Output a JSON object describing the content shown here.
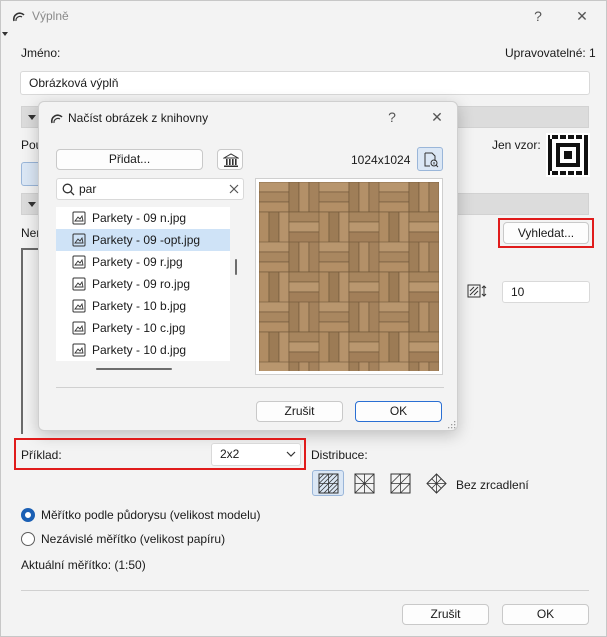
{
  "window": {
    "title": "Výplně",
    "help": "?",
    "close": "✕"
  },
  "name_section": {
    "label": "Jméno:",
    "editable_label": "Upravovatelné: 1",
    "value": "Obrázková výplň"
  },
  "behind": {
    "pou_label": "Pou",
    "jen_vzor_label": "Jen vzor:",
    "nem_label": "Nem",
    "search_button": "Vyhledat...",
    "size_value": "10"
  },
  "inner_dialog": {
    "title": "Načíst obrázek z knihovny",
    "help": "?",
    "close": "✕",
    "add_button": "Přidat...",
    "resolution": "1024x1024",
    "search_value": "par",
    "items": [
      {
        "label": "Parkety - 09 n.jpg",
        "selected": false
      },
      {
        "label": "Parkety - 09 -opt.jpg",
        "selected": true
      },
      {
        "label": "Parkety - 09 r.jpg",
        "selected": false
      },
      {
        "label": "Parkety - 09 ro.jpg",
        "selected": false
      },
      {
        "label": "Parkety - 10 b.jpg",
        "selected": false
      },
      {
        "label": "Parkety - 10 c.jpg",
        "selected": false
      },
      {
        "label": "Parkety - 10 d.jpg",
        "selected": false
      }
    ],
    "cancel_button": "Zrušit",
    "ok_button": "OK"
  },
  "example": {
    "label": "Příklad:",
    "value": "2x2"
  },
  "distribution": {
    "label": "Distribuce:",
    "mirror_label": "Bez zrcadlení"
  },
  "scale": {
    "option1": "Měřítko podle půdorysu (velikost modelu)",
    "option2": "Nezávislé měřítko (velikost papíru)",
    "selected": "option1",
    "current": "Aktuální měřítko: (1:50)"
  },
  "footer": {
    "cancel_button": "Zrušit",
    "ok_button": "OK"
  },
  "colors": {
    "accent": "#1a5fb4",
    "highlight": "#e01b1b",
    "selection": "#cfe3f7"
  }
}
